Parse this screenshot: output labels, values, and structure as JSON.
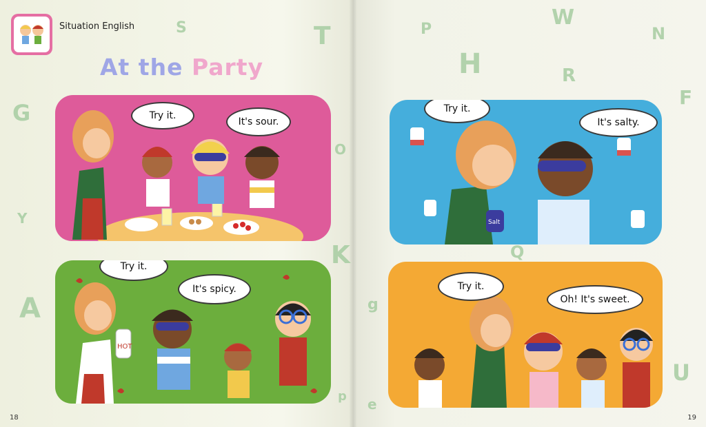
{
  "header": {
    "section": "Situation English"
  },
  "title": {
    "part1": "At the",
    "part2": "Party"
  },
  "panels": [
    {
      "bubbles": [
        "Try it.",
        "It's sour."
      ]
    },
    {
      "bubbles": [
        "Try it.",
        "It's spicy."
      ],
      "bottle": "HOT"
    },
    {
      "bubbles": [
        "Try it.",
        "It's salty."
      ],
      "jar": "Salt"
    },
    {
      "bubbles": [
        "Try it.",
        "Oh! It's sweet."
      ]
    }
  ],
  "decorative_letters": [
    "S",
    "T",
    "G",
    "Y",
    "A",
    "K",
    "P",
    "W",
    "N",
    "H",
    "R",
    "F",
    "Q",
    "U",
    "O",
    "g",
    "e",
    "p"
  ],
  "page_numbers": {
    "left": "18",
    "right": "19"
  },
  "colors": {
    "pink_panel": "#de5b9a",
    "green_panel": "#6cae3d",
    "blue_panel": "#45aedc",
    "orange_panel": "#f4a934",
    "title_lavender": "#9fa6e6",
    "title_pink": "#f0a7cc"
  }
}
